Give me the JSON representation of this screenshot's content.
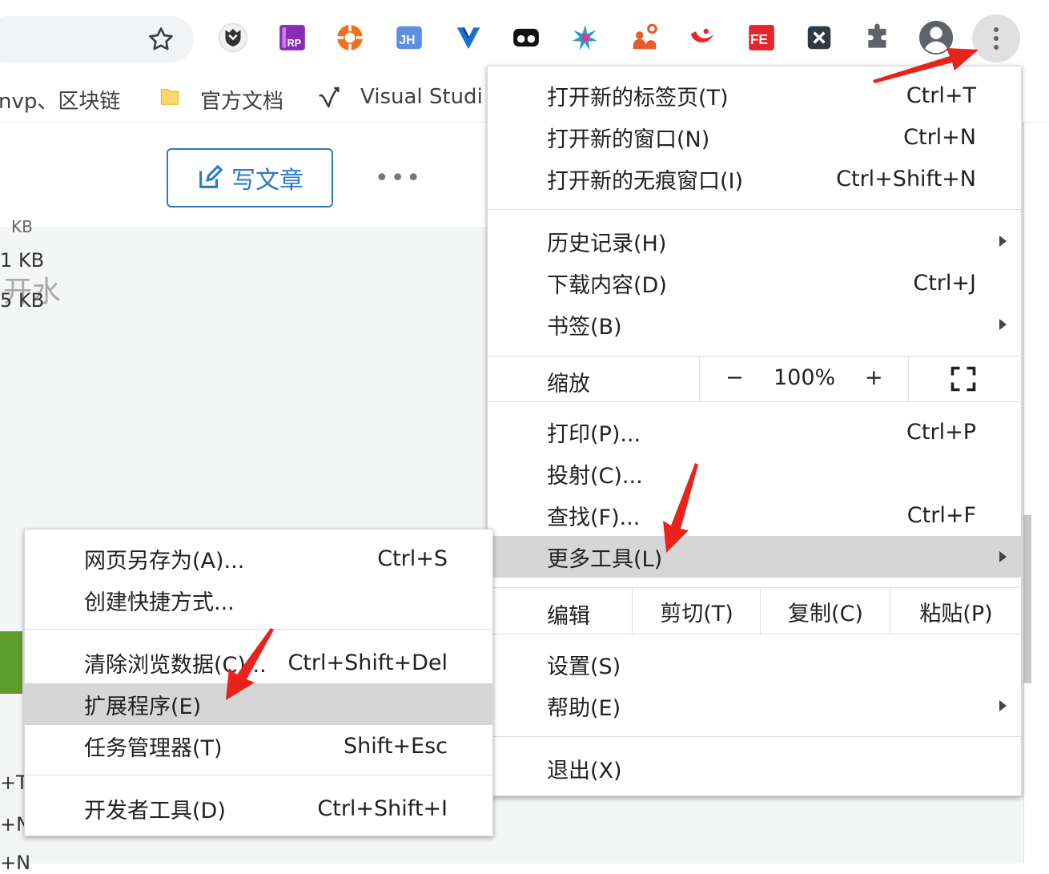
{
  "colors": {
    "accent": "#2c7bbf",
    "highlight": "#d6d6d6",
    "annotation_arrow": "#e8231b"
  },
  "bookmarks": [
    {
      "label": "nvp、区块链",
      "icon": ""
    },
    {
      "label": "官方文档",
      "icon": "folder-icon"
    },
    {
      "label": "Visual Studi",
      "icon": "visual-studio-icon"
    }
  ],
  "extensions": [
    "shield-extension-icon",
    "axure-rp-icon",
    "lifebuoy-extension-icon",
    "jh-extension-icon",
    "v-extension-icon",
    "glasses-extension-icon",
    "star-burst-extension-icon",
    "network-extension-icon",
    "swirl-extension-icon",
    "fe-extension-icon",
    "x-extension-icon",
    "puzzle-icon",
    "profile-icon",
    "kebab-menu-icon"
  ],
  "page": {
    "write_button": "写文章",
    "more_dots": "•••",
    "side_texts": [
      "KB",
      "1 KB",
      "开水",
      "5 KB",
      "+T",
      "+N",
      "+N"
    ]
  },
  "main_menu": {
    "new_tab": {
      "label": "打开新的标签页(T)",
      "shortcut": "Ctrl+T"
    },
    "new_window": {
      "label": "打开新的窗口(N)",
      "shortcut": "Ctrl+N"
    },
    "new_incognito": {
      "label": "打开新的无痕窗口(I)",
      "shortcut": "Ctrl+Shift+N"
    },
    "history": {
      "label": "历史记录(H)"
    },
    "downloads": {
      "label": "下载内容(D)",
      "shortcut": "Ctrl+J"
    },
    "bookmarks": {
      "label": "书签(B)"
    },
    "zoom": {
      "label": "缩放",
      "minus": "−",
      "level": "100%",
      "plus": "+"
    },
    "print": {
      "label": "打印(P)...",
      "shortcut": "Ctrl+P"
    },
    "cast": {
      "label": "投射(C)..."
    },
    "find": {
      "label": "查找(F)...",
      "shortcut": "Ctrl+F"
    },
    "more_tools": {
      "label": "更多工具(L)"
    },
    "edit": {
      "label": "编辑",
      "cut": "剪切(T)",
      "copy": "复制(C)",
      "paste": "粘贴(P)"
    },
    "settings": {
      "label": "设置(S)"
    },
    "help": {
      "label": "帮助(E)"
    },
    "exit": {
      "label": "退出(X)"
    }
  },
  "sub_menu": {
    "save_page": {
      "label": "网页另存为(A)...",
      "shortcut": "Ctrl+S"
    },
    "create_shortcut": {
      "label": "创建快捷方式..."
    },
    "clear_data": {
      "label": "清除浏览数据(C)...",
      "shortcut": "Ctrl+Shift+Del"
    },
    "extensions": {
      "label": "扩展程序(E)"
    },
    "task_manager": {
      "label": "任务管理器(T)",
      "shortcut": "Shift+Esc"
    },
    "dev_tools": {
      "label": "开发者工具(D)",
      "shortcut": "Ctrl+Shift+I"
    }
  }
}
